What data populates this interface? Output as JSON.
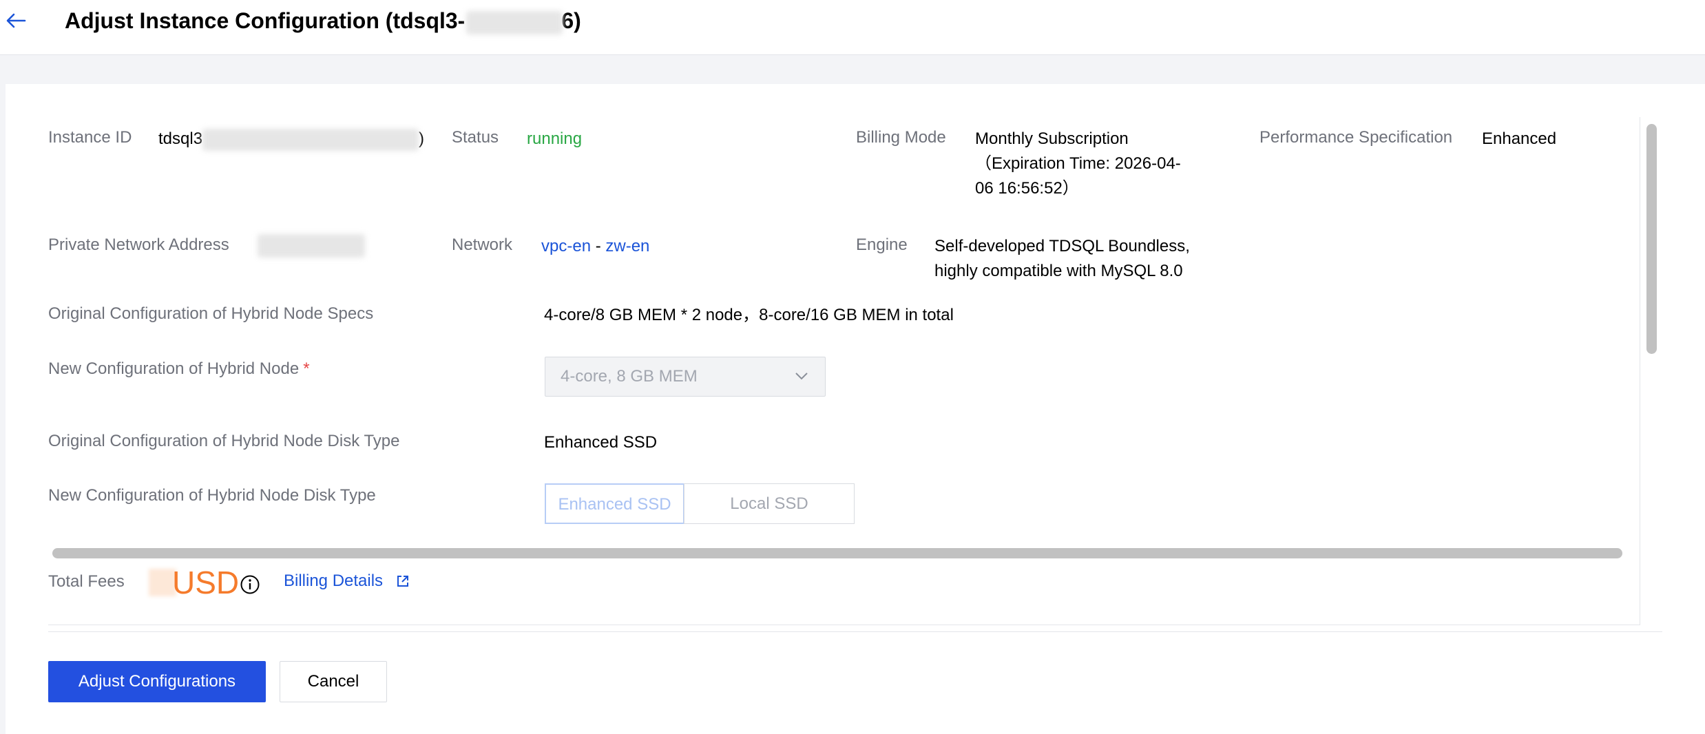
{
  "header": {
    "title_prefix": "Adjust Instance Configuration (tdsql3-",
    "title_suffix": "6)"
  },
  "info": {
    "instance_id_label": "Instance ID",
    "instance_id_prefix": "tdsql3",
    "instance_id_suffix": ")",
    "status_label": "Status",
    "status_value": "running",
    "billing_mode_label": "Billing Mode",
    "billing_mode_line1": "Monthly Subscription",
    "billing_mode_line2": "（Expiration Time: 2026-04-",
    "billing_mode_line3": "06 16:56:52）",
    "perf_spec_label": "Performance Specification",
    "perf_spec_value": "Enhanced",
    "private_addr_label": "Private Network Address",
    "network_label": "Network",
    "network_vpc": "vpc-en",
    "network_sep": " - ",
    "network_subnet": "zw-en",
    "engine_label": "Engine",
    "engine_line1": "Self-developed TDSQL Boundless,",
    "engine_line2": "highly compatible with MySQL 8.0"
  },
  "config": {
    "orig_node_specs_label": "Original Configuration of Hybrid Node Specs",
    "orig_node_specs_value": "4-core/8 GB MEM * 2 node，8-core/16 GB MEM in total",
    "new_node_label": "New Configuration of Hybrid Node",
    "required_mark": "*",
    "new_node_select_value": "4-core, 8 GB MEM",
    "orig_disk_label": "Original Configuration of Hybrid Node Disk Type",
    "orig_disk_value": "Enhanced SSD",
    "new_disk_label": "New Configuration of Hybrid Node Disk Type",
    "disk_options": [
      "Enhanced SSD",
      "Local SSD"
    ]
  },
  "footer": {
    "total_fees_label": "Total Fees",
    "fees_currency": "USD",
    "billing_details_label": "Billing Details",
    "adjust_button": "Adjust Configurations",
    "cancel_button": "Cancel"
  },
  "icons": {
    "back": "arrow-left-icon",
    "dropdown": "chevron-down-icon",
    "info": "info-circle-icon",
    "external": "external-link-icon"
  },
  "colors": {
    "accent": "#2350e0",
    "link": "#1b54d8",
    "status_running": "#29a744",
    "fees": "#f57b2c",
    "required": "#e54545"
  }
}
